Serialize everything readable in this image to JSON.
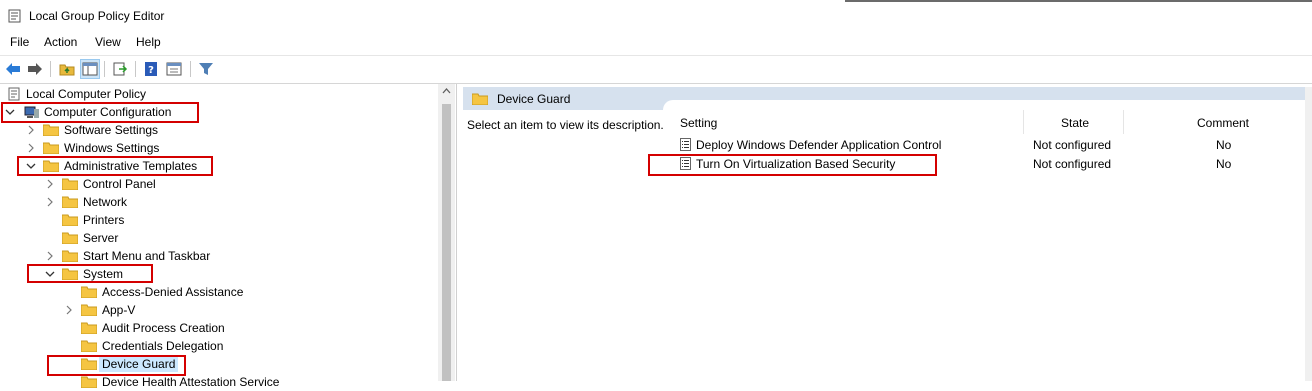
{
  "window": {
    "title": "Local Group Policy Editor"
  },
  "menu": [
    "File",
    "Action",
    "View",
    "Help"
  ],
  "toolbar": {
    "icons": [
      "back-icon",
      "forward-icon",
      "up-folder-icon",
      "show-hide-tree-icon",
      "export-list-icon",
      "help-icon",
      "properties-icon",
      "filter-icon"
    ]
  },
  "tree": {
    "root": "Local Computer Policy",
    "computer_configuration": "Computer Configuration",
    "software_settings": "Software Settings",
    "windows_settings": "Windows Settings",
    "administrative_templates": "Administrative Templates",
    "control_panel": "Control Panel",
    "network": "Network",
    "printers": "Printers",
    "server": "Server",
    "start_menu": "Start Menu and Taskbar",
    "system": "System",
    "access_denied": "Access-Denied Assistance",
    "app_v": "App-V",
    "audit_process": "Audit Process Creation",
    "credentials_delegation": "Credentials Delegation",
    "device_guard": "Device Guard",
    "device_health": "Device Health Attestation Service"
  },
  "details": {
    "header": "Device Guard",
    "description": "Select an item to view its description.",
    "columns": {
      "setting": "Setting",
      "state": "State",
      "comment": "Comment"
    },
    "rows": [
      {
        "setting": "Deploy Windows Defender Application Control",
        "state": "Not configured",
        "comment": "No"
      },
      {
        "setting": "Turn On Virtualization Based Security",
        "state": "Not configured",
        "comment": "No"
      }
    ]
  },
  "colors": {
    "highlight_box": "#d40000",
    "folder": "#f5c542",
    "header_band": "#d6e1ee",
    "selection": "#cce8ff"
  }
}
